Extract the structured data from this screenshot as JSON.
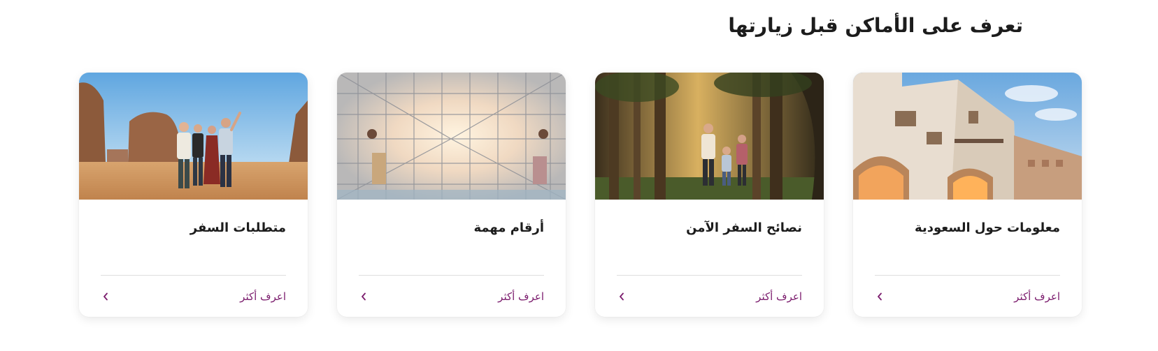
{
  "section": {
    "title": "تعرف على الأماكن قبل زيارتها"
  },
  "theme": {
    "accent": "#7b1c6d",
    "text": "#1c1c1c",
    "divider": "#dddddd"
  },
  "cards": [
    {
      "title": "معلومات حول السعودية",
      "link_label": "اعرف أكثر",
      "image": "historic-white-building-with-carved-arches"
    },
    {
      "title": "نصائح السفر الآمن",
      "link_label": "اعرف أكثر",
      "image": "family-walking-in-palm-grove"
    },
    {
      "title": "أرقام مهمة",
      "link_label": "اعرف أكثر",
      "image": "glass-and-steel-station-hall"
    },
    {
      "title": "متطلبات السفر",
      "link_label": "اعرف أكثر",
      "image": "friends-taking-selfie-near-rock-formations"
    }
  ]
}
